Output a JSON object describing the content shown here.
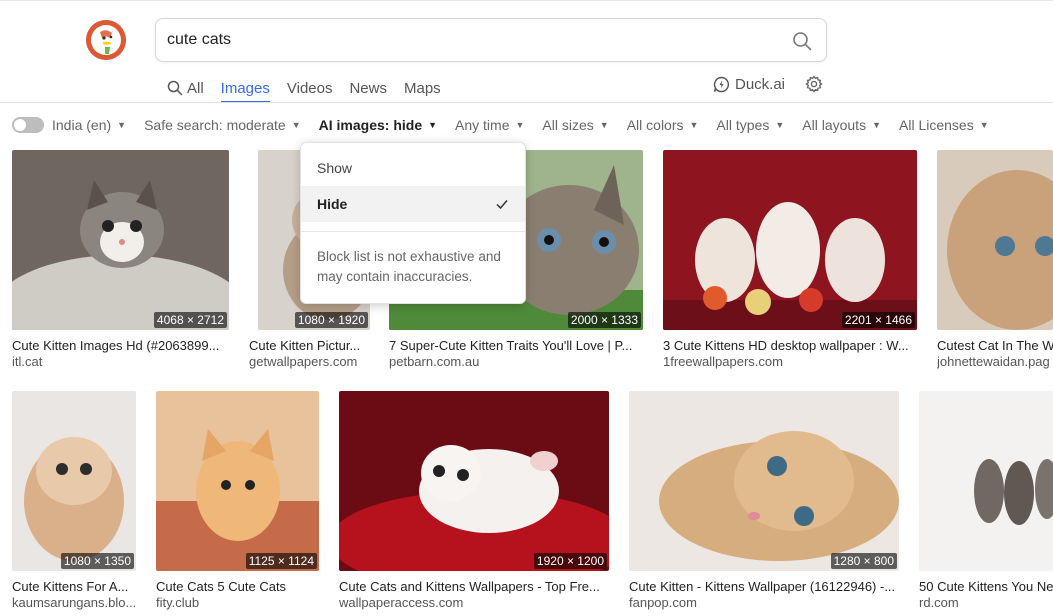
{
  "search": {
    "query": "cute cats"
  },
  "nav": {
    "tabs": [
      {
        "label": "All"
      },
      {
        "label": "Images"
      },
      {
        "label": "Videos"
      },
      {
        "label": "News"
      },
      {
        "label": "Maps"
      }
    ],
    "active": "Images",
    "duckai_label": "Duck.ai"
  },
  "filters": {
    "region": "India (en)",
    "safe_search": "Safe search: moderate",
    "ai_images": "AI images: hide",
    "time": "Any time",
    "sizes": "All sizes",
    "colors": "All colors",
    "types": "All types",
    "layouts": "All layouts",
    "licenses": "All Licenses"
  },
  "ai_dropdown": {
    "options": [
      {
        "label": "Show",
        "selected": false
      },
      {
        "label": "Hide",
        "selected": true
      }
    ],
    "note": "Block list is not exhaustive and may contain inaccuracies."
  },
  "results": [
    {
      "caption": "Cute Kitten Images Hd (#2063899...",
      "source": "itl.cat",
      "dims": "4068 × 2712"
    },
    {
      "caption": "Cute Kitten Pictur...",
      "source": "getwallpapers.com",
      "dims": "1080 × 1920"
    },
    {
      "caption": "7 Super-Cute Kitten Traits You'll Love | P...",
      "source": "petbarn.com.au",
      "dims": "2000 × 1333"
    },
    {
      "caption": "3 Cute Kittens HD desktop wallpaper : W...",
      "source": "1freewallpapers.com",
      "dims": "2201 × 1466"
    },
    {
      "caption": "Cutest Cat In The W",
      "source": "johnettewaidan.pag",
      "dims": ""
    },
    {
      "caption": "Cute Kittens For A...",
      "source": "kaumsarungans.blo...",
      "dims": "1080 × 1350"
    },
    {
      "caption": "Cute Cats 5 Cute Cats",
      "source": "fity.club",
      "dims": "1125 × 1124"
    },
    {
      "caption": "Cute Cats and Kittens Wallpapers - Top Fre...",
      "source": "wallpaperaccess.com",
      "dims": "1920 × 1200"
    },
    {
      "caption": "Cute Kitten - Kittens Wallpaper (16122946) -...",
      "source": "fanpop.com",
      "dims": "1280 × 800"
    },
    {
      "caption": "50 Cute Kittens You Ne",
      "source": "rd.com",
      "dims": ""
    }
  ],
  "colors": {
    "accent": "#3969ef",
    "logo": "#de5833"
  }
}
